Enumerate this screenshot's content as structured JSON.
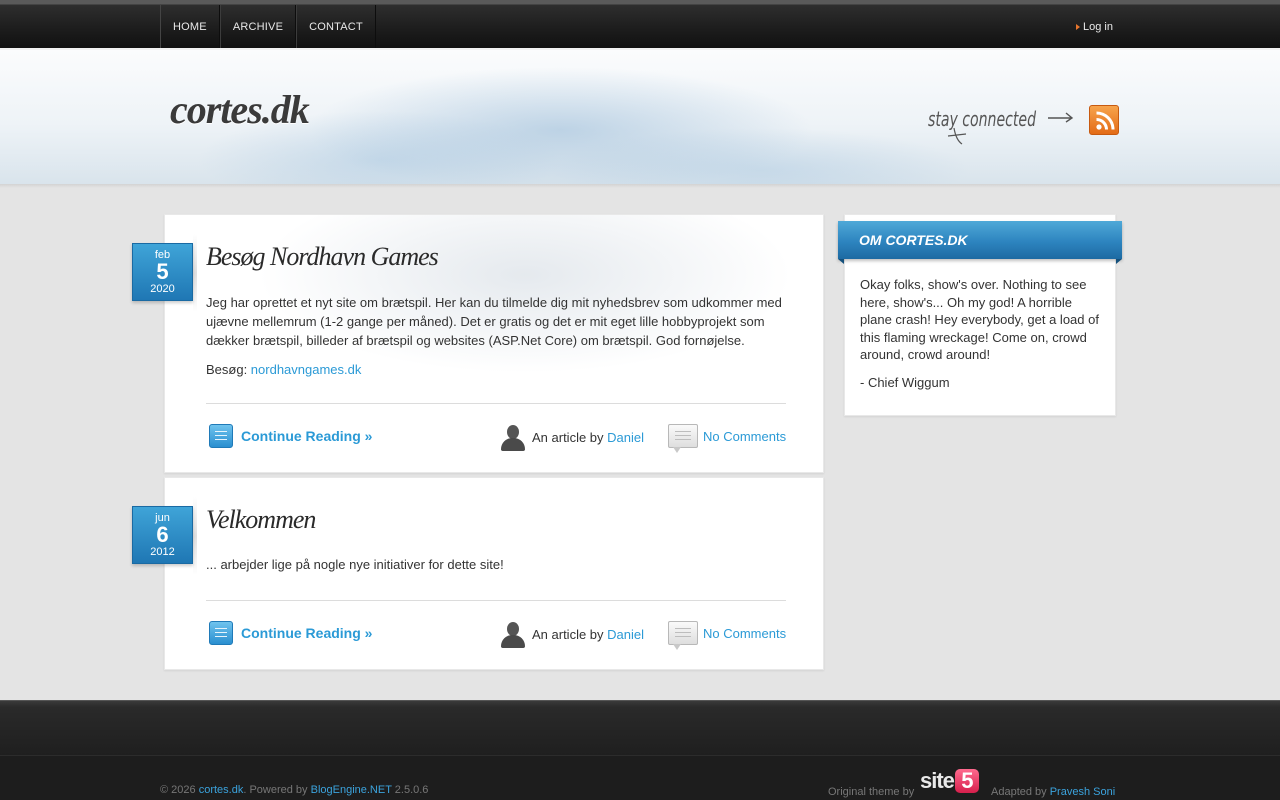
{
  "nav": {
    "items": [
      "HOME",
      "ARCHIVE",
      "CONTACT"
    ],
    "login": "Log in"
  },
  "header": {
    "site_title": "cortes.dk",
    "stay_connected": "stay connected",
    "rss_icon": "rss-feed-icon"
  },
  "posts": [
    {
      "month": "feb",
      "day": "5",
      "year": "2020",
      "title": "Besøg Nordhavn Games",
      "body": "Jeg har oprettet et nyt site om brætspil. Her kan du tilmelde dig mit nyhedsbrev som udkommer med ujævne mellemrum (1-2 gange per måned). Det er gratis og det er mit eget lille hobbyprojekt som dækker brætspil, billeder af brætspil og websites (ASP.Net Core) om brætspil. God fornøjelse.",
      "visit_label": "Besøg: ",
      "visit_link": "nordhavngames.dk",
      "continue": "Continue Reading »",
      "author_prefix": "An article by ",
      "author": "Daniel",
      "comments": "No Comments"
    },
    {
      "month": "jun",
      "day": "6",
      "year": "2012",
      "title": "Velkommen",
      "body": "... arbejder lige på nogle nye initiativer for dette site!",
      "continue": "Continue Reading »",
      "author_prefix": "An article by ",
      "author": "Daniel",
      "comments": "No Comments"
    }
  ],
  "sidebar": {
    "title": "OM CORTES.DK",
    "text": "Okay folks, show's over. Nothing to see here, show's... Oh my god! A horrible plane crash! Hey everybody, get a load of this flaming wreckage! Come on, crowd around, crowd around!",
    "quote_by": "- Chief Wiggum"
  },
  "footer": {
    "copyright_prefix": "© 2026 ",
    "site_link": "cortes.dk",
    "powered_by": ". Powered by ",
    "engine_link": "BlogEngine.NET",
    "version": " 2.5.0.6",
    "original_theme": "Original theme by",
    "theme_logo_text": "site",
    "theme_logo_num": "5",
    "adapted_by": "Adapted by ",
    "adapter_link": "Pravesh Soni"
  },
  "colors": {
    "accent": "#2b9ad6",
    "date_badge": "#2a8bc8",
    "nav_bg": "#1c1c1c",
    "rss": "#f08a28"
  }
}
